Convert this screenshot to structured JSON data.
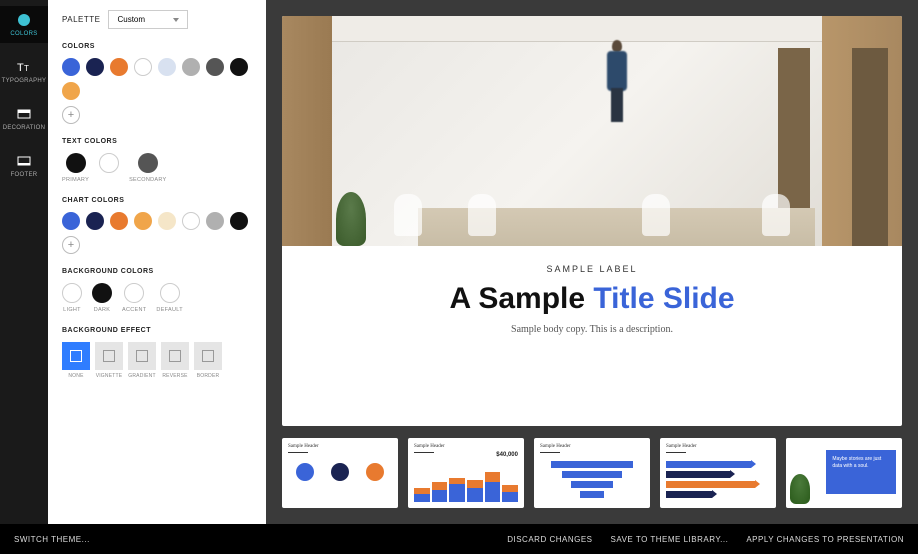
{
  "vnav": {
    "items": [
      {
        "label": "COLORS",
        "icon": "palette-icon",
        "active": true,
        "color": "#3ec1d3"
      },
      {
        "label": "TYPOGRAPHY",
        "icon": "type-icon",
        "active": false,
        "color": "#fff"
      },
      {
        "label": "DECORATION",
        "icon": "rectangle-icon",
        "active": false,
        "color": "#fff"
      },
      {
        "label": "FOOTER",
        "icon": "footer-icon",
        "active": false,
        "color": "#fff"
      }
    ]
  },
  "palette": {
    "label": "PALETTE",
    "value": "Custom"
  },
  "sections": {
    "colors": {
      "title": "COLORS",
      "swatches": [
        "#3a64d8",
        "#1a2352",
        "#e87a2f",
        "#ffffff",
        "#d8e1f0",
        "#b0b0b0",
        "#555555",
        "#111111",
        "#f0a54a"
      ]
    },
    "text_colors": {
      "title": "TEXT COLORS",
      "items": [
        {
          "color": "#111111",
          "label": "PRIMARY"
        },
        {
          "color": "#ffffff",
          "label": "",
          "bordered": true
        },
        {
          "color": "#555555",
          "label": "SECONDARY"
        }
      ]
    },
    "chart_colors": {
      "title": "CHART COLORS",
      "swatches": [
        "#3a64d8",
        "#1a2352",
        "#e87a2f",
        "#f0a54a",
        "#f5e6c8",
        "#ffffff",
        "#b0b0b0",
        "#111111"
      ]
    },
    "background_colors": {
      "title": "BACKGROUND COLORS",
      "items": [
        {
          "color": "#ffffff",
          "label": "LIGHT",
          "bordered": true
        },
        {
          "color": "#111111",
          "label": "DARK"
        },
        {
          "color": "#ffffff",
          "label": "ACCENT",
          "bordered": true
        },
        {
          "color": "#ffffff",
          "label": "DEFAULT",
          "bordered": true
        }
      ]
    },
    "background_effect": {
      "title": "BACKGROUND EFFECT",
      "items": [
        {
          "label": "NONE",
          "active": true
        },
        {
          "label": "VIGNETTE",
          "active": false
        },
        {
          "label": "GRADIENT",
          "active": false
        },
        {
          "label": "REVERSE",
          "active": false
        },
        {
          "label": "BORDER",
          "active": false
        }
      ]
    }
  },
  "slide": {
    "label": "SAMPLE LABEL",
    "title_a": "A Sample ",
    "title_b": "Title Slide",
    "body": "Sample body copy. This is a description."
  },
  "thumbs": {
    "t1": {
      "title": "Sample Header",
      "icons": [
        "#3a64d8",
        "#1a2352",
        "#e87a2f"
      ]
    },
    "t2": {
      "title": "Sample Header",
      "value": "$40,000"
    },
    "t3": {
      "title": "Sample Header"
    },
    "t4": {
      "title": "Sample Header"
    },
    "t5": {
      "quote": "Maybe stories are just data with a soul."
    }
  },
  "footer": {
    "switch": "SWITCH THEME...",
    "discard": "DISCARD CHANGES",
    "save": "SAVE TO THEME LIBRARY...",
    "apply": "APPLY CHANGES TO PRESENTATION"
  }
}
